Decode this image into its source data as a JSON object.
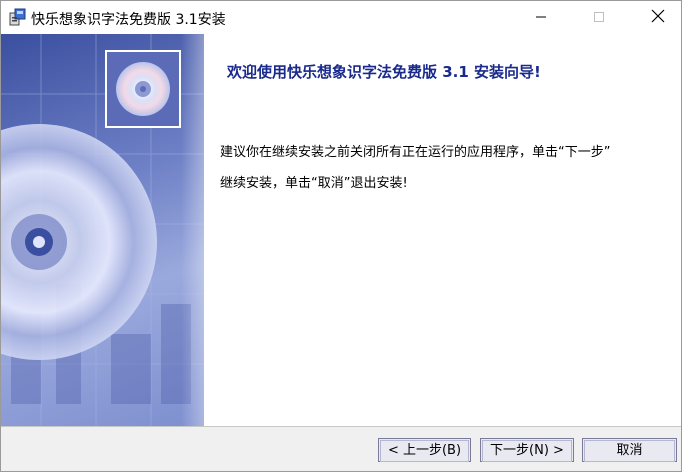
{
  "window": {
    "title": "快乐想象识字法免费版 3.1安装",
    "icons": {
      "app": "installer-icon",
      "minimize": "minimize-icon",
      "maximize": "maximize-icon",
      "close": "close-icon"
    }
  },
  "banner": {
    "images": [
      "cd-disc-icon",
      "cd-disc-large-image"
    ]
  },
  "content": {
    "heading": "欢迎使用快乐想象识字法免费版 3.1 安装向导!",
    "lines": [
      "建议你在继续安装之前关闭所有正在运行的应用程序，单击“下一步”",
      "继续安装，单击“取消”退出安装!"
    ]
  },
  "buttons": {
    "back": "< 上一步(B)",
    "next": "下一步(N) >",
    "cancel": "取消"
  },
  "colors": {
    "heading": "#1a2a8c",
    "banner": "#6f81c6"
  }
}
